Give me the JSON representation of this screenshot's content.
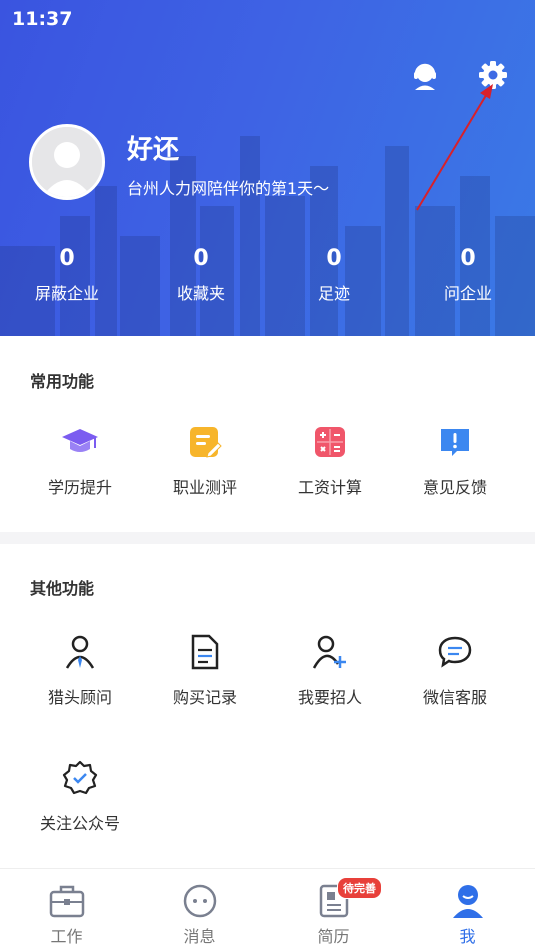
{
  "status_bar": {
    "time": "11:37"
  },
  "profile": {
    "name": "好还",
    "slogan": "台州人力网陪伴你的第1天～"
  },
  "stats": [
    {
      "value": "0",
      "label": "屏蔽企业"
    },
    {
      "value": "0",
      "label": "收藏夹"
    },
    {
      "value": "0",
      "label": "足迹"
    },
    {
      "value": "0",
      "label": "问企业"
    }
  ],
  "common_features": {
    "title": "常用功能",
    "items": [
      {
        "label": "学历提升",
        "icon": "graduation-cap-icon"
      },
      {
        "label": "职业测评",
        "icon": "note-edit-icon"
      },
      {
        "label": "工资计算",
        "icon": "calculator-icon"
      },
      {
        "label": "意见反馈",
        "icon": "feedback-icon"
      }
    ]
  },
  "other_features": {
    "title": "其他功能",
    "items": [
      {
        "label": "猎头顾问",
        "icon": "headhunter-icon"
      },
      {
        "label": "购买记录",
        "icon": "document-icon"
      },
      {
        "label": "我要招人",
        "icon": "add-user-icon"
      },
      {
        "label": "微信客服",
        "icon": "chat-bubble-icon"
      },
      {
        "label": "关注公众号",
        "icon": "verified-badge-icon"
      }
    ]
  },
  "tabbar": {
    "items": [
      {
        "label": "工作",
        "icon": "briefcase-icon"
      },
      {
        "label": "消息",
        "icon": "message-icon"
      },
      {
        "label": "简历",
        "icon": "resume-icon",
        "badge": "待完善"
      },
      {
        "label": "我",
        "icon": "user-icon",
        "active": true
      }
    ]
  },
  "colors": {
    "brand": "#2f6fe8",
    "header_start": "#3a54e0",
    "badge": "#e8403a"
  }
}
